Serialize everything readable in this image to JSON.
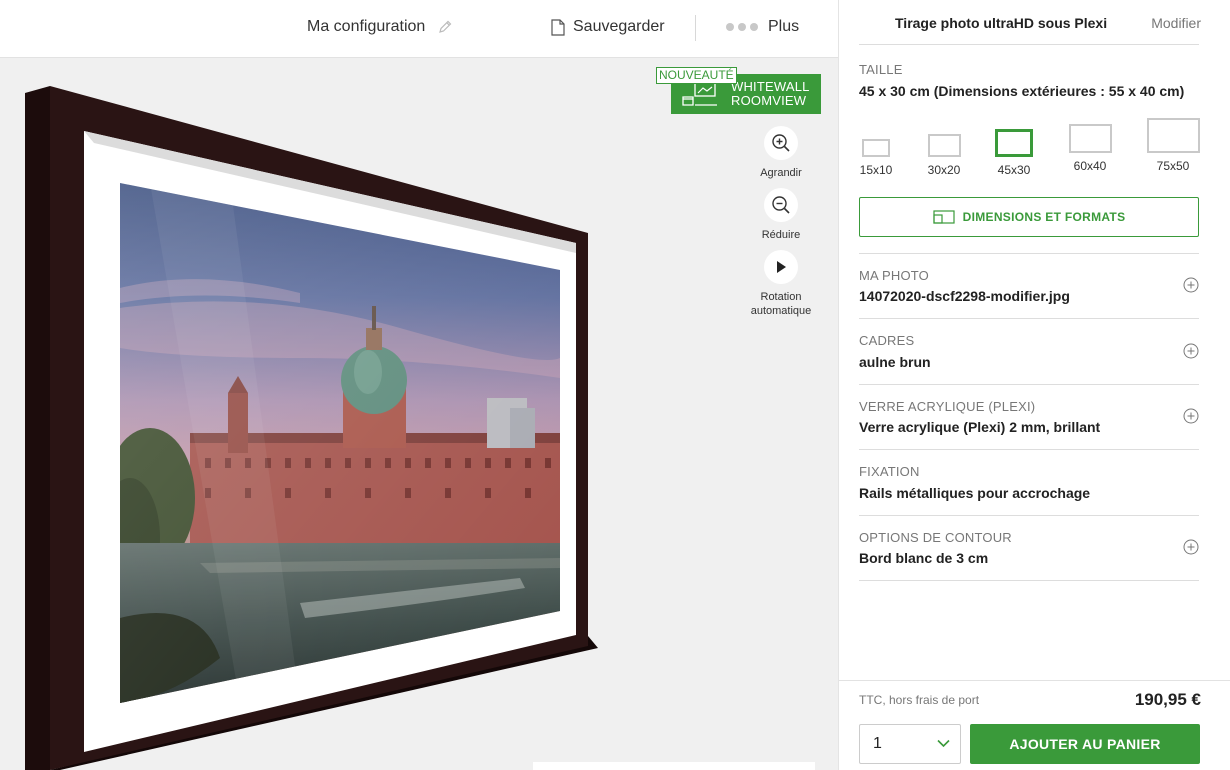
{
  "topbar": {
    "config_label": "Ma configuration",
    "save_label": "Sauvegarder",
    "more_label": "Plus"
  },
  "preview": {
    "badge_new": "NOUVEAUTÉ",
    "roomview_line1": "WHITEWALL",
    "roomview_line2": "ROOMVIEW",
    "tools": {
      "zoom_in": "Agrandir",
      "zoom_out": "Réduire",
      "rotate_line1": "Rotation",
      "rotate_line2": "automatique"
    }
  },
  "panel": {
    "product_title": "Tirage photo ultraHD sous Plexi",
    "modify_label": "Modifier",
    "size": {
      "label": "TAILLE",
      "value": "45 x 30 cm (Dimensions extérieures : 55 x 40 cm)",
      "options": [
        "15x10",
        "30x20",
        "45x30",
        "60x40",
        "75x50"
      ],
      "selected": "45x30",
      "button_label": "DIMENSIONS ET FORMATS"
    },
    "photo": {
      "label": "MA PHOTO",
      "value": "14072020-dscf2298-modifier.jpg"
    },
    "frames": {
      "label": "CADRES",
      "value": "aulne brun"
    },
    "glass": {
      "label": "VERRE ACRYLIQUE (PLEXI)",
      "value": "Verre acrylique (Plexi) 2 mm, brillant"
    },
    "mounting": {
      "label": "FIXATION",
      "value": "Rails métalliques pour accrochage"
    },
    "edge": {
      "label": "OPTIONS DE CONTOUR",
      "value": "Bord blanc de 3 cm"
    }
  },
  "checkout": {
    "tax_note": "TTC, hors frais de port",
    "price": "190,95 €",
    "quantity": "1",
    "add_to_cart_label": "AJOUTER AU PANIER"
  },
  "colors": {
    "accent": "#3a9a3a",
    "frame": "#2a1414"
  }
}
